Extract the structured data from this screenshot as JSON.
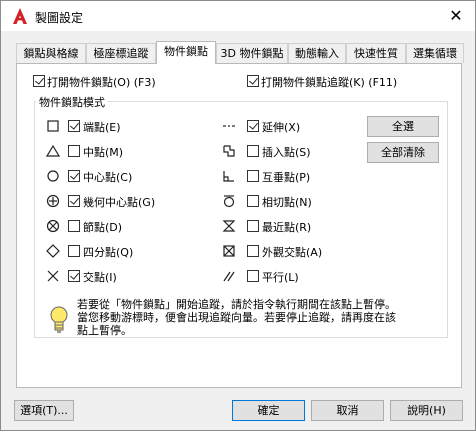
{
  "window": {
    "title": "製圖設定",
    "close_glyph": "✕",
    "brand_color": "#d41f26"
  },
  "tabs": [
    "鎖點與格線",
    "極座標追蹤",
    "物件鎖點",
    "3D 物件鎖點",
    "動態輸入",
    "快速性質",
    "選集循環"
  ],
  "active_tab_index": 2,
  "top_options": {
    "osnap_on": {
      "label": "打開物件鎖點(O) (F3)",
      "checked": true
    },
    "tracking_on": {
      "label": "打開物件鎖點追蹤(K) (F11)",
      "checked": true
    }
  },
  "group": {
    "title": "物件鎖點模式",
    "left_items": [
      {
        "icon": "endpoint-square-icon",
        "label": "端點(E)",
        "checked": true
      },
      {
        "icon": "midpoint-triangle-icon",
        "label": "中點(M)",
        "checked": false
      },
      {
        "icon": "center-circle-icon",
        "label": "中心點(C)",
        "checked": true
      },
      {
        "icon": "geometric-center-icon",
        "label": "幾何中心點(G)",
        "checked": true
      },
      {
        "icon": "node-icon",
        "label": "節點(D)",
        "checked": false
      },
      {
        "icon": "quadrant-diamond-icon",
        "label": "四分點(Q)",
        "checked": false
      },
      {
        "icon": "intersection-x-icon",
        "label": "交點(I)",
        "checked": true
      }
    ],
    "right_items": [
      {
        "icon": "extension-icon",
        "label": "延伸(X)",
        "checked": true
      },
      {
        "icon": "insertion-icon",
        "label": "插入點(S)",
        "checked": false
      },
      {
        "icon": "perpendicular-icon",
        "label": "互垂點(P)",
        "checked": false
      },
      {
        "icon": "tangent-icon",
        "label": "相切點(N)",
        "checked": false
      },
      {
        "icon": "nearest-icon",
        "label": "最近點(R)",
        "checked": false
      },
      {
        "icon": "apparent-intersection-icon",
        "label": "外觀交點(A)",
        "checked": false
      },
      {
        "icon": "parallel-icon",
        "label": "平行(L)",
        "checked": false
      }
    ],
    "select_all": "全選",
    "clear_all": "全部清除"
  },
  "hint": "若要從「物件鎖點」開始追蹤，請於指令執行期間在該點上暫停。\n當您移動游標時，便會出現追蹤向量。若要停止追蹤，請再度在該\n點上暫停。",
  "footer": {
    "options": "選項(T)...",
    "ok": "確定",
    "cancel": "取消",
    "help": "說明(H)"
  }
}
